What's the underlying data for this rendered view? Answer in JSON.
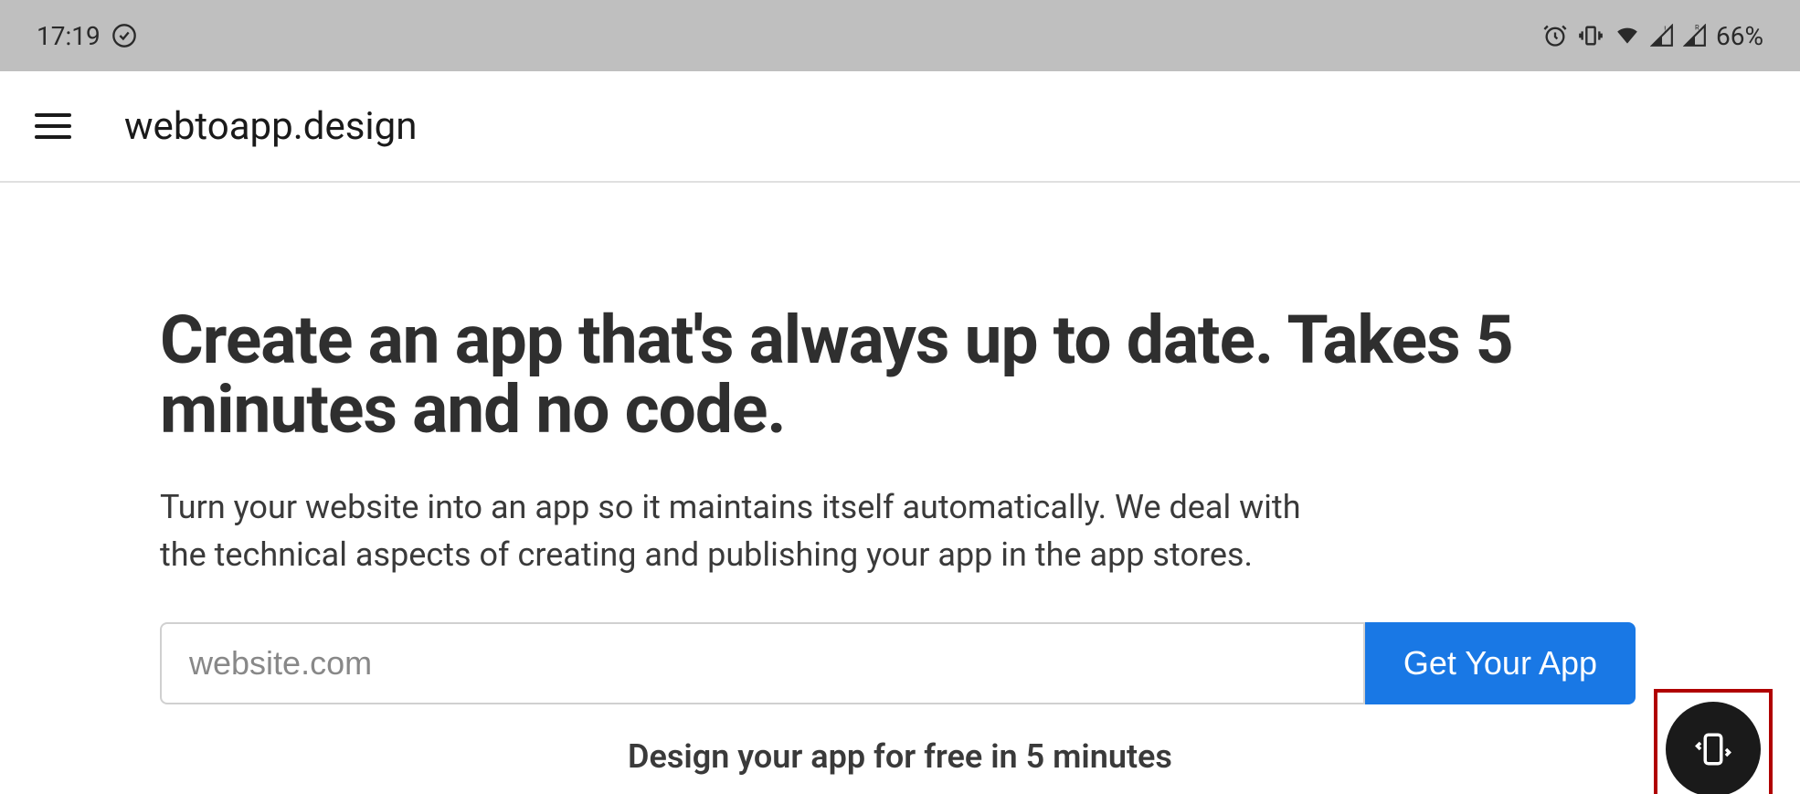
{
  "status_bar": {
    "time": "17:19",
    "battery": "66%"
  },
  "app_bar": {
    "title": "webtoapp.design"
  },
  "content": {
    "headline": "Create an app that's always up to date. Takes 5 minutes and no code.",
    "subheadline": "Turn your website into an app so it maintains itself automatically. We deal with the technical aspects of creating and publishing your app in the app stores.",
    "url_placeholder": "website.com",
    "cta_label": "Get Your App",
    "footer_text": "Design your app for free in 5 minutes"
  }
}
